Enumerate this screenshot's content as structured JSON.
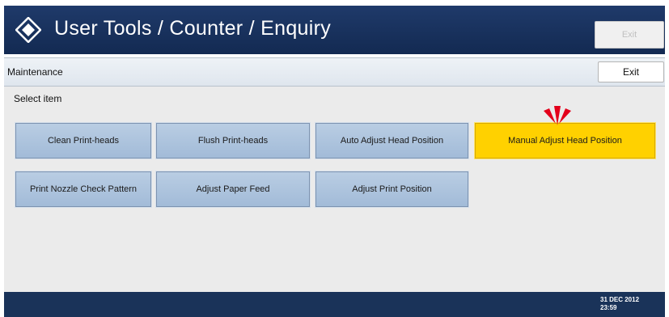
{
  "header": {
    "title": "User Tools / Counter / Enquiry",
    "exit_label": "Exit",
    "logo_icon": "diamond-logo-icon"
  },
  "subheader": {
    "section_label": "Maintenance",
    "exit_label": "Exit"
  },
  "content": {
    "prompt": "Select item",
    "items": [
      {
        "label": "Clean Print-heads",
        "selected": false
      },
      {
        "label": "Flush Print-heads",
        "selected": false
      },
      {
        "label": "Auto Adjust Head Position",
        "selected": false
      },
      {
        "label": "Manual Adjust Head Position",
        "selected": true
      },
      {
        "label": "Print Nozzle Check Pattern",
        "selected": false
      },
      {
        "label": "Adjust Paper Feed",
        "selected": false
      },
      {
        "label": "Adjust Print Position",
        "selected": false
      }
    ],
    "pointer_icon": "red-burst-pointer-icon"
  },
  "footer": {
    "date": "31 DEC 2012",
    "time": "23:59"
  },
  "colors": {
    "titlebar": "#1f3a6a",
    "button_blue": "#b9cde3",
    "button_selected": "#ffd100",
    "footer": "#1a3359",
    "pointer": "#e3001b"
  }
}
